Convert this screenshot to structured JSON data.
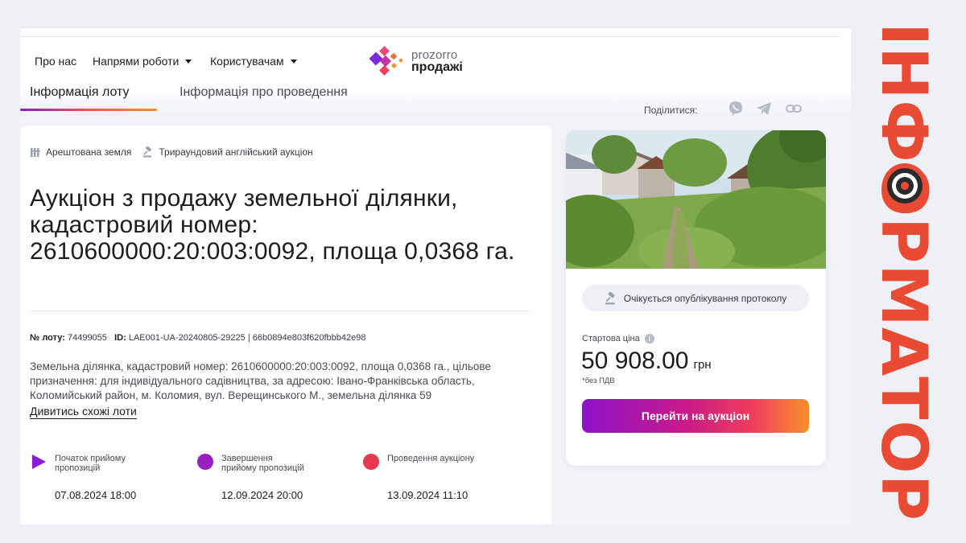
{
  "header": {
    "nav": [
      "Про нас",
      "Напрями роботи",
      "Користувачам"
    ],
    "logo_top": "prozorro",
    "logo_bottom": "продажі"
  },
  "tabs": [
    "Інформація лоту",
    "Інформація про проведення"
  ],
  "share": {
    "label": "Поділитися:",
    "icons": [
      "viber-icon",
      "telegram-icon",
      "link-icon"
    ]
  },
  "lot": {
    "tags": [
      "Арештована земля",
      "Трираундовий англійський аукціон"
    ],
    "title": "Аукціон з продажу земельної ділянки, кадастровий номер: 2610600000:20:003:0092, площа 0,0368 га.",
    "lot_no_label": "№ лоту:",
    "lot_no": "74499055",
    "id_label": "ID:",
    "id": "LAE001-UA-20240805-29225",
    "separator": "|",
    "hash": "66b0894e803f620fbbb42e98",
    "description": "Земельна ділянка, кадастровий номер: 2610600000:20:003:0092, площа 0,0368 га., цільове призначення: для індивідуального садівництва, за адресою: Івано-Франківська область, Коломийський район, м. Коломия, вул. Верещинського М., земельна ділянка 59",
    "similar_link": "Дивитись схожі лоти"
  },
  "phases": [
    {
      "label": "Початок прийому пропозицій",
      "date": "07.08.2024   18:00",
      "color": "#8c1bd6"
    },
    {
      "label": "Завершення прийому пропозицій",
      "date": "12.09.2024   20:00",
      "color": "#9a1fbf"
    },
    {
      "label": "Проведення аукціону",
      "date": "13.09.2024   11:10",
      "color": "#e8384f"
    }
  ],
  "side": {
    "status": "Очікується опублікування протоколу",
    "price_label": "Стартова ціна",
    "price": "50 908.00",
    "currency": "грн",
    "vat": "*без ПДВ",
    "cta": "Перейти на аукціон"
  },
  "brand": {
    "text": "ІНФОРМАТОР",
    "color": "#e94a34"
  }
}
